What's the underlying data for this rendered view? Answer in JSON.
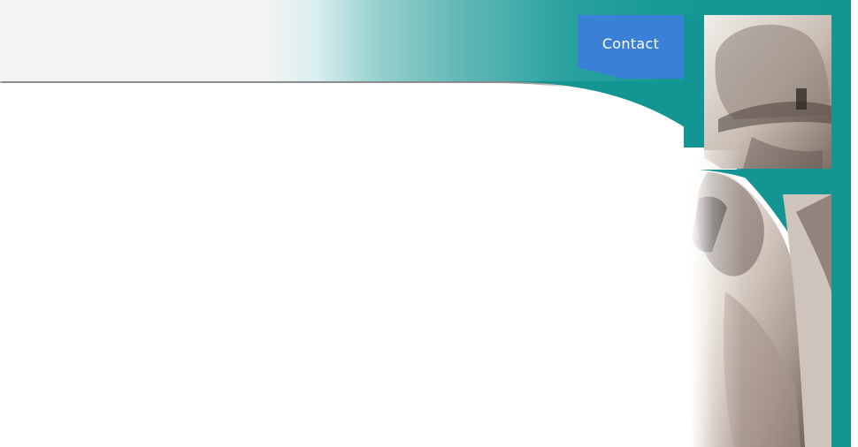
{
  "header": {
    "contact_label": "Contact"
  },
  "colors": {
    "teal": "#129593",
    "header_background": "#f3f3f3",
    "contact_blue": "#3a80d6",
    "photo_sepia": "#c7b9ad"
  },
  "icons": {
    "photo_top": "worker-hardhat-photo",
    "photo_bottom": "worker-phone-photo"
  }
}
